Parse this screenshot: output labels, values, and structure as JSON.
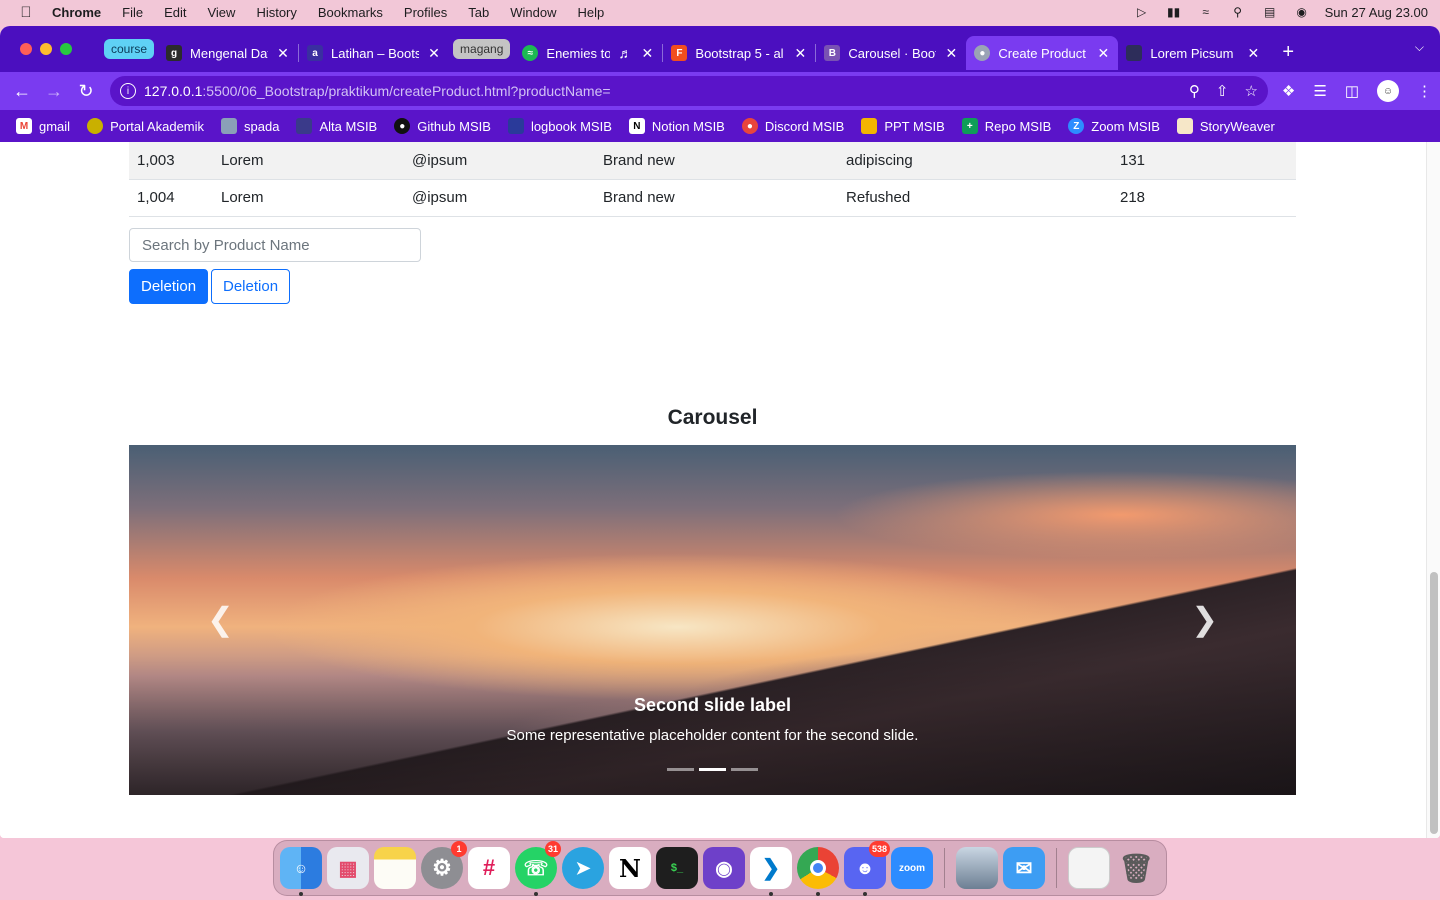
{
  "menubar": {
    "app_name": "Chrome",
    "items": [
      "File",
      "Edit",
      "View",
      "History",
      "Bookmarks",
      "Profiles",
      "Tab",
      "Window",
      "Help"
    ],
    "clock": "Sun 27 Aug  23.00"
  },
  "tabs": {
    "group_course": "course",
    "group_magang": "magang",
    "items": [
      {
        "title": "Mengenal Data",
        "icon": "g-icon"
      },
      {
        "title": "Latihan – Boots",
        "icon": "alterra-icon"
      },
      {
        "title": "Enemies to",
        "icon": "spotify-icon"
      },
      {
        "title": "Bootstrap 5 - al",
        "icon": "figma-icon"
      },
      {
        "title": "Carousel · Boot",
        "icon": "bootstrap-icon"
      },
      {
        "title": "Create Product",
        "icon": "globe-icon",
        "active": true
      },
      {
        "title": "Lorem Picsum",
        "icon": "picsum-icon"
      }
    ]
  },
  "address_bar": {
    "host": "127.0.0.1",
    "path": ":5500/06_Bootstrap/praktikum/createProduct.html?productName="
  },
  "bookmarks": [
    {
      "label": "gmail",
      "icon": "gmail-icon",
      "color": "#ea4335"
    },
    {
      "label": "Portal Akademik",
      "icon": "portal-icon",
      "color": "#c9b000"
    },
    {
      "label": "spada",
      "icon": "spada-icon",
      "color": "#8aa0b8"
    },
    {
      "label": "Alta MSIB",
      "icon": "alta-icon",
      "color": "#3a3a8a"
    },
    {
      "label": "Github MSIB",
      "icon": "github-icon",
      "color": "#111111"
    },
    {
      "label": "logbook MSIB",
      "icon": "logbook-icon",
      "color": "#2a3a9a"
    },
    {
      "label": "Notion MSIB",
      "icon": "notion-icon",
      "color": "#ffffff"
    },
    {
      "label": "Discord MSIB",
      "icon": "discord-icon",
      "color": "#e8453c"
    },
    {
      "label": "PPT MSIB",
      "icon": "slides-icon",
      "color": "#f4b400"
    },
    {
      "label": "Repo MSIB",
      "icon": "sheets-icon",
      "color": "#0f9d58"
    },
    {
      "label": "Zoom MSIB",
      "icon": "zoom-icon",
      "color": "#2d8cff"
    },
    {
      "label": "StoryWeaver",
      "icon": "storyweaver-icon",
      "color": "#f6e7c8"
    }
  ],
  "table": {
    "rows": [
      [
        "1,003",
        "Lorem",
        "@ipsum",
        "Brand new",
        "adipiscing",
        "131"
      ],
      [
        "1,004",
        "Lorem",
        "@ipsum",
        "Brand new",
        "Refushed",
        "218"
      ]
    ]
  },
  "form": {
    "search_placeholder": "Search by Product Name",
    "btn_primary": "Deletion",
    "btn_outline": "Deletion"
  },
  "carousel": {
    "heading": "Carousel",
    "slide_label": "Second slide label",
    "slide_text": "Some representative placeholder content for the second slide.",
    "prev_icon": "chevron-left-icon",
    "next_icon": "chevron-right-icon",
    "active_index": 1,
    "indicator_count": 3
  },
  "dock": {
    "settings_badge": "1",
    "whatsapp_badge": "31",
    "discord_badge": "538",
    "zoom_label": "zoom"
  },
  "colors": {
    "tab_strip": "#4b0fbf",
    "toolbar": "#7a3bf0",
    "primary": "#0d6efd"
  }
}
